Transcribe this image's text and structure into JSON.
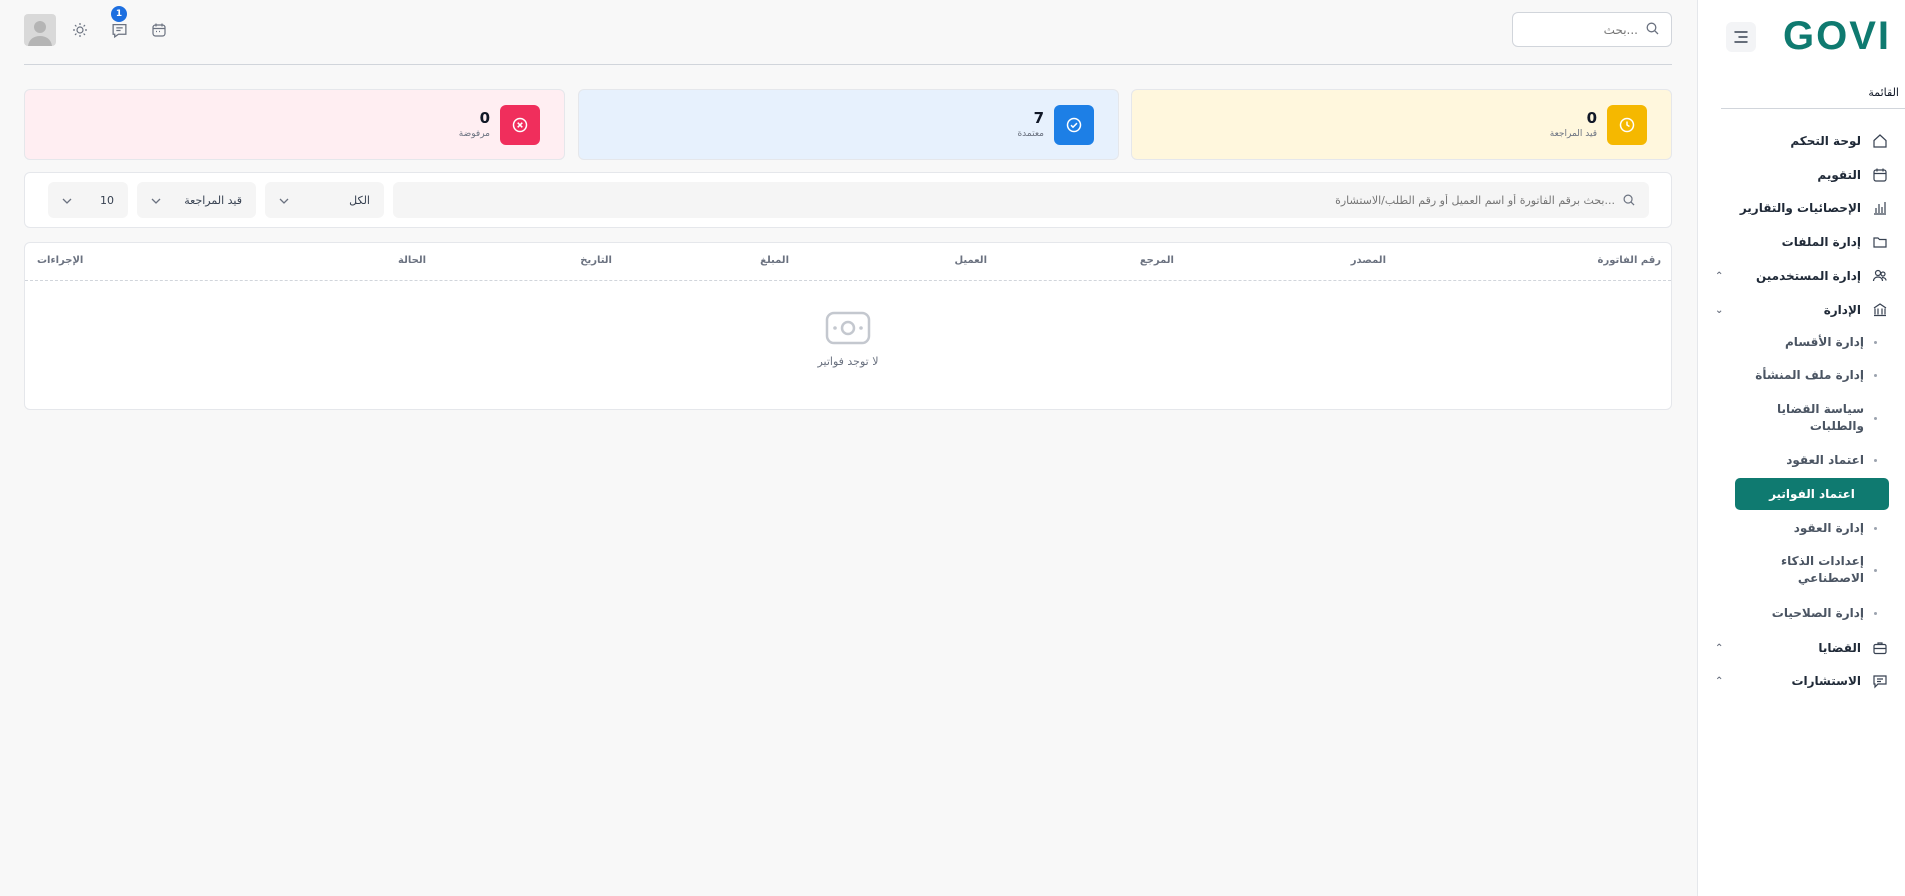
{
  "sidebar": {
    "logo": "GOVI",
    "menu_heading": "القائمة",
    "items": [
      {
        "label": "لوحة التحكم"
      },
      {
        "label": "التقويم"
      },
      {
        "label": "الإحصائيات والتقارير"
      },
      {
        "label": "إدارة الملفات"
      },
      {
        "label": "إدارة المستخدمين"
      },
      {
        "label": "الإدارة"
      },
      {
        "label": "القضايا"
      },
      {
        "label": "الاستشارات"
      }
    ],
    "sub_items": [
      {
        "label": "إدارة الأقسام"
      },
      {
        "label": "إدارة ملف المنشأة"
      },
      {
        "label": "سياسة القضايا والطلبات"
      },
      {
        "label": "اعتماد العقود"
      },
      {
        "label": "اعتماد الفواتير"
      },
      {
        "label": "إدارة العقود"
      },
      {
        "label": "إعدادات الذكاء الاصطناعي"
      },
      {
        "label": "إدارة الصلاحيات"
      }
    ],
    "active_sub_item": "اعتماد الفواتير"
  },
  "header": {
    "search_placeholder": "بحث...",
    "notification_count": "1"
  },
  "stats": [
    {
      "value": "0",
      "label": "قيد المراجعة",
      "color": "#f5b800",
      "bg": "#fff7dd"
    },
    {
      "value": "7",
      "label": "معتمدة",
      "color": "#1d7fe6",
      "bg": "#e7f1fd"
    },
    {
      "value": "0",
      "label": "مرفوضة",
      "color": "#f02e5c",
      "bg": "#ffeef2"
    }
  ],
  "filters": {
    "search_placeholder": "بحث برقم الفاتورة أو اسم العميل أو رقم الطلب/الاستشارة...",
    "type_value": "الكل",
    "status_value": "قيد المراجعة",
    "page_size": "10"
  },
  "table": {
    "columns": [
      "رقم الفاتورة",
      "المصدر",
      "المرجع",
      "العميل",
      "المبلغ",
      "التاريخ",
      "الحالة",
      "الإجراءات"
    ],
    "empty_message": "لا توجد فواتير"
  },
  "colors": {
    "brand": "#0f7a70"
  }
}
